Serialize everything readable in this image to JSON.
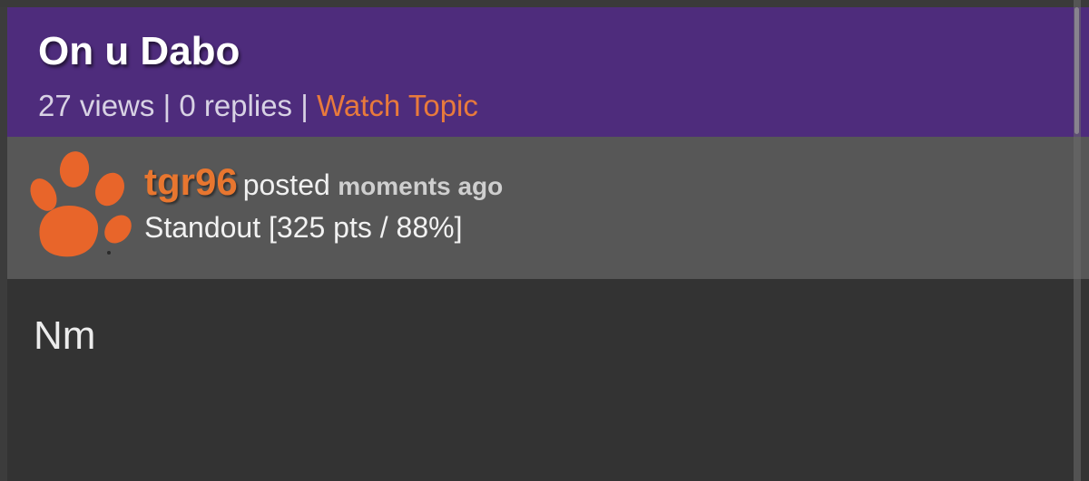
{
  "topic": {
    "title": "On u Dabo",
    "views": "27 views",
    "separator": "|",
    "replies": "0 replies",
    "watch_label": "Watch Topic"
  },
  "post": {
    "username": "tgr96",
    "posted_label": "posted",
    "time": "moments ago",
    "rank": "Standout [325 pts / 88%]",
    "avatar_icon": "paw-icon",
    "body": "Nm"
  },
  "colors": {
    "header_bg": "#4e2c7c",
    "accent_orange": "#e8762f",
    "post_head_bg": "#575757",
    "body_bg": "#333333"
  }
}
